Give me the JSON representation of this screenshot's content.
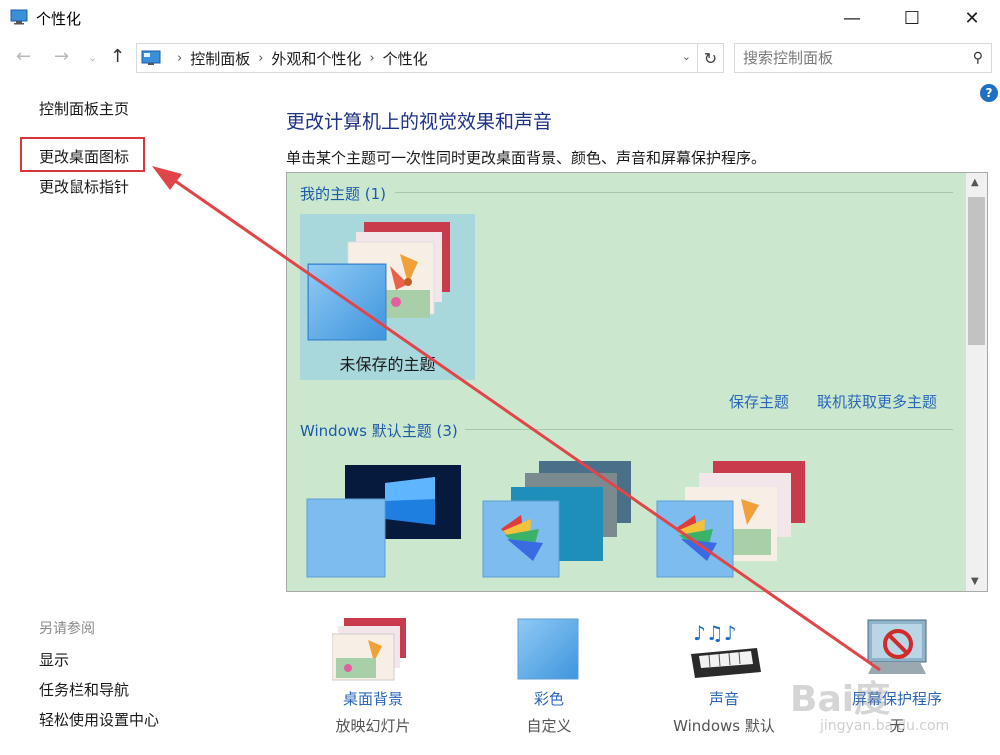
{
  "window": {
    "title": "个性化",
    "minimize": "—",
    "maximize": "☐",
    "close": "✕"
  },
  "nav": {
    "back": "←",
    "forward": "→",
    "recent": "⌄",
    "up": "↑",
    "breadcrumb": [
      "控制面板",
      "外观和个性化",
      "个性化"
    ],
    "breadcrumb_sep": "›",
    "refresh": "↻",
    "search_placeholder": "搜索控制面板"
  },
  "help_label": "?",
  "sidebar": {
    "home": "控制面板主页",
    "change_desktop_icons": "更改桌面图标",
    "change_mouse_pointer": "更改鼠标指针",
    "see_also": "另请参阅",
    "links": [
      "显示",
      "任务栏和导航",
      "轻松使用设置中心"
    ]
  },
  "main": {
    "title": "更改计算机上的视觉效果和声音",
    "description": "单击某个主题可一次性同时更改桌面背景、颜色、声音和屏幕保护程序。",
    "my_themes_label": "我的主题 (1)",
    "unsaved_theme": "未保存的主题",
    "save_theme": "保存主题",
    "get_more_themes": "联机获取更多主题",
    "windows_themes_label": "Windows 默认主题 (3)"
  },
  "bottom": {
    "background": {
      "label": "桌面背景",
      "value": "放映幻灯片"
    },
    "color": {
      "label": "彩色",
      "value": "自定义"
    },
    "sound": {
      "label": "声音",
      "value": "Windows 默认"
    },
    "screensaver": {
      "label": "屏幕保护程序",
      "value": "无"
    }
  },
  "watermark": {
    "text": "Bai度",
    "url": "jingyan.baidu.com"
  },
  "colors": {
    "accent": "#1e3287",
    "link": "#2a67b8",
    "panel": "#cbe8cf",
    "annotation": "#d9373b"
  },
  "icons": {
    "app": "control-panel-icon",
    "search": "search-icon",
    "help": "help-icon"
  }
}
